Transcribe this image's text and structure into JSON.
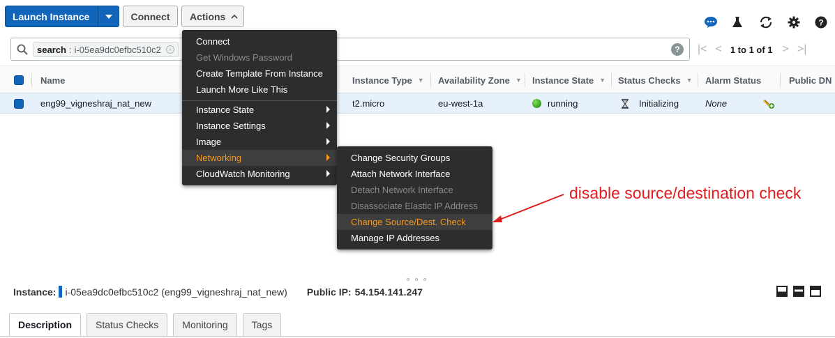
{
  "toolbar": {
    "launch_label": "Launch Instance",
    "connect_label": "Connect",
    "actions_label": "Actions",
    "icons": [
      "chat-icon",
      "flask-icon",
      "refresh-icon",
      "gear-icon",
      "help-icon"
    ]
  },
  "search": {
    "token_key": "search",
    "token_sep": ":",
    "token_value": "i-05ea9dc0efbc510c2",
    "pagination": "1 to 1 of 1"
  },
  "table": {
    "columns": [
      "Name",
      "Instance Type",
      "Availability Zone",
      "Instance State",
      "Status Checks",
      "Alarm Status",
      "Public DN"
    ],
    "row": {
      "name": "eng99_vigneshraj_nat_new",
      "instance_type": "t2.micro",
      "availability_zone": "eu-west-1a",
      "instance_state": "running",
      "status_checks": "Initializing",
      "alarm_status": "None"
    }
  },
  "actions_menu": {
    "items": [
      {
        "label": "Connect",
        "disabled": false
      },
      {
        "label": "Get Windows Password",
        "disabled": true
      },
      {
        "label": "Create Template From Instance",
        "disabled": false
      },
      {
        "label": "Launch More Like This",
        "disabled": false
      },
      {
        "label": "Instance State",
        "submenu": true
      },
      {
        "label": "Instance Settings",
        "submenu": true
      },
      {
        "label": "Image",
        "submenu": true
      },
      {
        "label": "Networking",
        "submenu": true,
        "highlighted": true
      },
      {
        "label": "CloudWatch Monitoring",
        "submenu": true
      }
    ]
  },
  "networking_menu": {
    "items": [
      {
        "label": "Change Security Groups",
        "disabled": false
      },
      {
        "label": "Attach Network Interface",
        "disabled": false
      },
      {
        "label": "Detach Network Interface",
        "disabled": true
      },
      {
        "label": "Disassociate Elastic IP Address",
        "disabled": true
      },
      {
        "label": "Change Source/Dest. Check",
        "highlighted": true
      },
      {
        "label": "Manage IP Addresses",
        "disabled": false
      }
    ]
  },
  "annotation": {
    "text": "disable source/destination check",
    "color": "#e01c1c"
  },
  "details": {
    "instance_label": "Instance:",
    "instance_value": "i-05ea9dc0efbc510c2 (eng99_vigneshraj_nat_new)",
    "public_ip_label": "Public IP:",
    "public_ip_value": "54.154.141.247",
    "tabs": [
      "Description",
      "Status Checks",
      "Monitoring",
      "Tags"
    ]
  },
  "colors": {
    "primary": "#1166bb",
    "menu_bg": "#2d2d2d",
    "menu_highlight": "#f7981d",
    "row_selected": "#e7f1fb",
    "running": "#1d8102"
  }
}
